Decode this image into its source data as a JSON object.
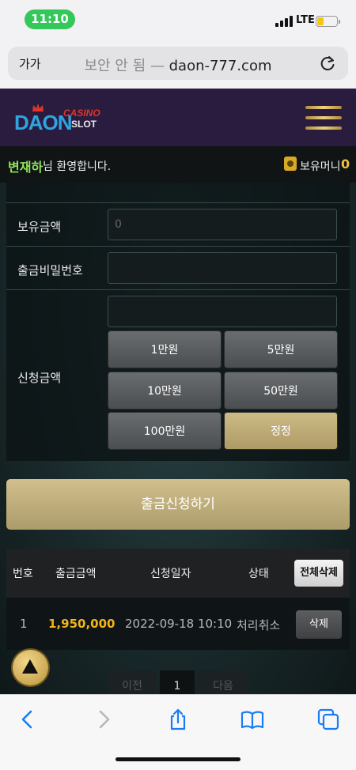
{
  "status_bar": {
    "time": "11:10",
    "network": "LTE",
    "battery_level": 0.3
  },
  "address_bar": {
    "text_size_label": "가가",
    "insecure_label": "보안 안 됨 —",
    "domain": "daon-777.com"
  },
  "site": {
    "logo": {
      "main": "DAON",
      "casino": "CASINO",
      "slot": "SLOT"
    },
    "welcome": {
      "name": "변재하",
      "message": "님 환영합니다.",
      "wallet_label": "보유머니",
      "wallet_amount": "0"
    }
  },
  "form": {
    "balance_label": "보유금액",
    "balance_value": "0",
    "password_label": "출금비밀번호",
    "request_label": "신청금액",
    "amount_buttons": [
      "1만원",
      "5만원",
      "10만원",
      "50만원",
      "100만원",
      "정정"
    ],
    "submit_label": "출금신청하기"
  },
  "history": {
    "columns": [
      "번호",
      "출금금액",
      "신청일자",
      "상태"
    ],
    "delete_all_label": "전체삭제",
    "rows": [
      {
        "no": "1",
        "amount": "1,950,000",
        "date": "2022-09-18 10:10",
        "status": "처리취소",
        "delete_label": "삭제"
      }
    ]
  },
  "pagination": {
    "prev": "이전",
    "current": "1",
    "next": "다음"
  },
  "colors": {
    "accent_gold": "#c9b47e",
    "nav_purple": "#2a1c3f",
    "amount_yellow": "#f2b418",
    "name_green": "#8fe35a",
    "time_pill": "#34c759"
  }
}
